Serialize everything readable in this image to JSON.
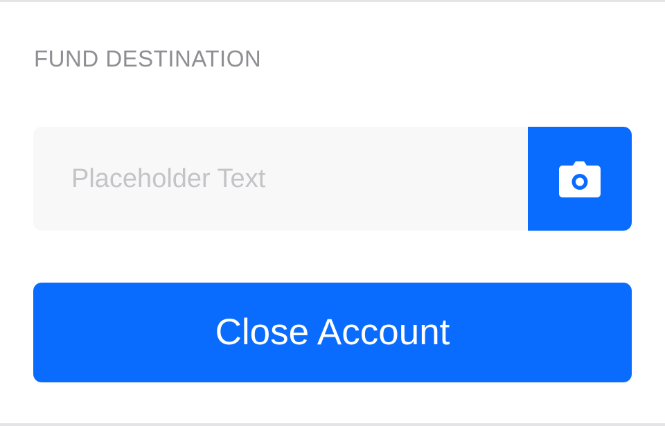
{
  "section": {
    "label": "FUND DESTINATION"
  },
  "destination_input": {
    "value": "",
    "placeholder": "Placeholder Text"
  },
  "camera_button": {
    "icon": "camera-icon"
  },
  "actions": {
    "close_account_label": "Close Account"
  },
  "colors": {
    "accent": "#0a6cff",
    "label": "#8e8e93",
    "input_background": "#f8f8f8",
    "placeholder": "#c4c4c8",
    "divider": "#e4e4e6"
  }
}
